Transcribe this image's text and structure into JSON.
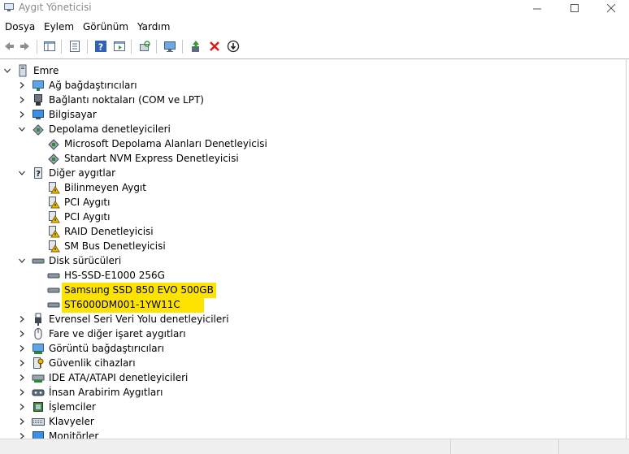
{
  "window": {
    "title": "Aygıt Yöneticisi",
    "minimize_glyph": "—",
    "maximize_glyph": "☐",
    "close_glyph": "✕"
  },
  "menu": [
    "Dosya",
    "Eylem",
    "Görünüm",
    "Yardım"
  ],
  "toolbar": {
    "icons": [
      "back-icon",
      "forward-icon",
      "show-hide-tree-icon",
      "properties-icon",
      "help-icon",
      "show-tab-icon",
      "scan-hardware-icon",
      "monitor-icon",
      "update-driver-icon",
      "uninstall-icon",
      "disable-icon"
    ]
  },
  "colors": {
    "highlight": "#fde400",
    "accent_blue": "#1a73c8",
    "warning": "#f3c300",
    "delete_red": "#d6201b"
  },
  "tree": {
    "root": "Emre",
    "net_adapters": "Ağ bağdaştırıcıları",
    "ports": "Bağlantı noktaları (COM ve LPT)",
    "computer": "Bilgisayar",
    "storage_ctrl": "Depolama denetleyicileri",
    "storage_ms": "Microsoft Depolama Alanları Denetleyicisi",
    "storage_nvme": "Standart NVM Express Denetleyicisi",
    "other": "Diğer aygıtlar",
    "other_unknown": "Bilinmeyen Aygıt",
    "other_pci1": "PCI Aygıtı",
    "other_pci2": "PCI Aygıtı",
    "other_raid": "RAID Denetleyicisi",
    "other_smbus": "SM Bus Denetleyicisi",
    "disks": "Disk sürücüleri",
    "disk_hs": "HS-SSD-E1000 256G",
    "disk_samsung": "Samsung SSD 850 EVO 500GB",
    "disk_st": "ST6000DM001-1YW11C",
    "usb": "Evrensel Seri Veri Yolu denetleyicileri",
    "mouse": "Fare ve diğer işaret aygıtları",
    "display": "Görüntü bağdaştırıcıları",
    "security": "Güvenlik cihazları",
    "ide": "IDE ATA/ATAPI denetleyicileri",
    "hid": "İnsan Arabirim Aygıtları",
    "cpu": "İşlemciler",
    "keyboards": "Klavyeler",
    "monitors": "Monitörler"
  }
}
